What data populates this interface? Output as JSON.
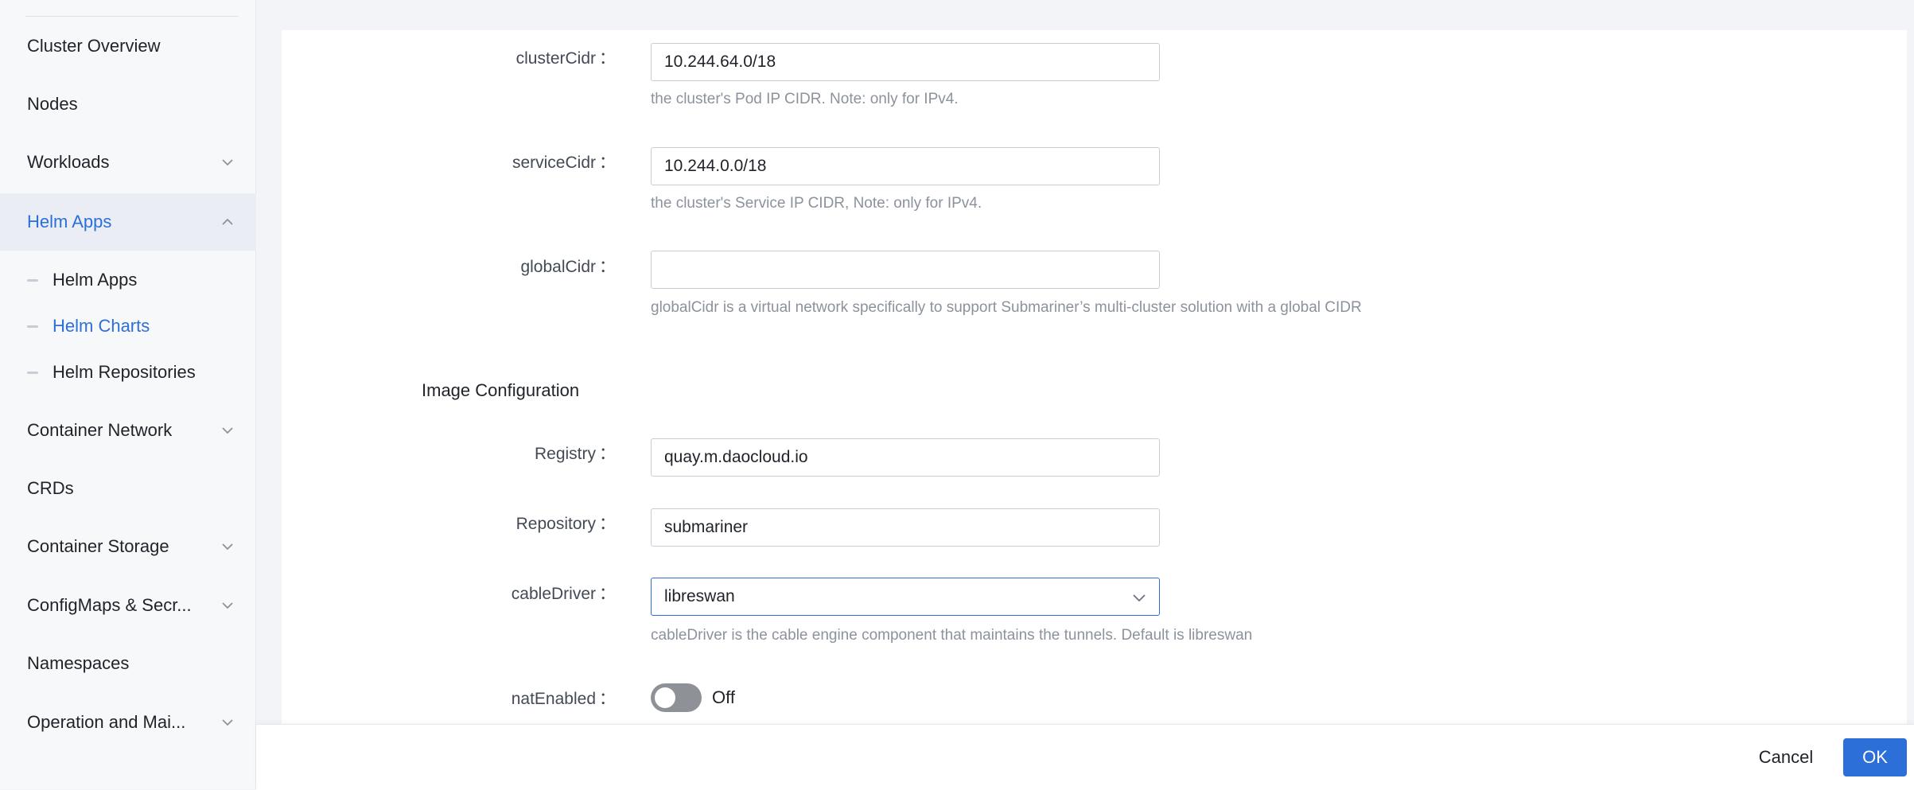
{
  "sidebar": {
    "items": [
      {
        "label": "Cluster Overview",
        "has_chevron": false,
        "active": false
      },
      {
        "label": "Nodes",
        "has_chevron": false,
        "active": false
      },
      {
        "label": "Workloads",
        "has_chevron": true,
        "active": false
      },
      {
        "label": "Helm Apps",
        "has_chevron": true,
        "active": true,
        "expanded": true
      },
      {
        "label": "Container Network",
        "has_chevron": true,
        "active": false
      },
      {
        "label": "CRDs",
        "has_chevron": false,
        "active": false
      },
      {
        "label": "Container Storage",
        "has_chevron": true,
        "active": false
      },
      {
        "label": "ConfigMaps & Secr...",
        "has_chevron": true,
        "active": false
      },
      {
        "label": "Namespaces",
        "has_chevron": false,
        "active": false
      },
      {
        "label": "Operation and Mai...",
        "has_chevron": true,
        "active": false
      }
    ],
    "helm_sub_items": [
      {
        "label": "Helm Apps",
        "active": false
      },
      {
        "label": "Helm Charts",
        "active": true
      },
      {
        "label": "Helm Repositories",
        "active": false
      }
    ]
  },
  "form": {
    "clusterCidr": {
      "label": "clusterCidr",
      "value": "10.244.64.0/18",
      "hint": "the cluster's Pod IP CIDR. Note: only for IPv4."
    },
    "serviceCidr": {
      "label": "serviceCidr",
      "value": "10.244.0.0/18",
      "hint": "the cluster's Service IP CIDR, Note: only for IPv4."
    },
    "globalCidr": {
      "label": "globalCidr",
      "value": "",
      "hint": "globalCidr is a virtual network specifically to support Submariner’s multi-cluster solution with a global CIDR"
    },
    "image_section_title": "Image Configuration",
    "registry": {
      "label": "Registry",
      "value": "quay.m.daocloud.io"
    },
    "repository": {
      "label": "Repository",
      "value": "submariner"
    },
    "cableDriver": {
      "label": "cableDriver",
      "value": "libreswan",
      "hint": "cableDriver is the cable engine component that maintains the tunnels. Default is libreswan"
    },
    "natEnabled": {
      "label": "natEnabled",
      "state_text": "Off",
      "on": false
    },
    "colon": "："
  },
  "footer": {
    "cancel_label": "Cancel",
    "ok_label": "OK"
  },
  "colors": {
    "accent": "#2d6fd8",
    "toggle_off": "#8e9298"
  }
}
